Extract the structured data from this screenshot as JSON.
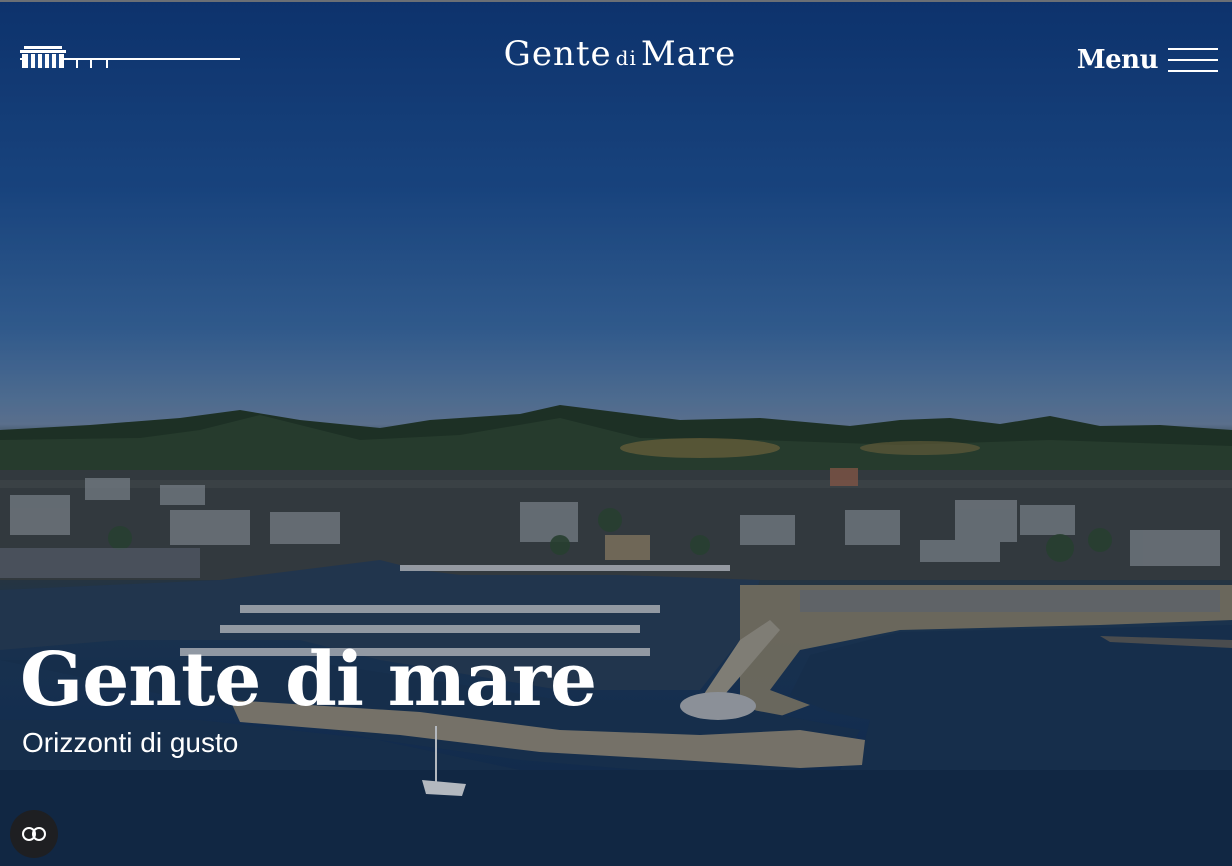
{
  "header": {
    "logo": {
      "part1": "Gente",
      "part2": "di",
      "part3": "Mare"
    },
    "menu_label": "Menu"
  },
  "hero": {
    "title": "Gente di mare",
    "subtitle": "Orizzonti di gusto"
  },
  "icons": {
    "brand_left": "pier-building-icon",
    "menu": "hamburger-icon",
    "accessibility": "accessibility-link-icon"
  },
  "colors": {
    "text": "#ffffff",
    "sky_top": "#0f3a7d",
    "sea": "#17345a",
    "accessibility_bg": "#1e1f22"
  }
}
